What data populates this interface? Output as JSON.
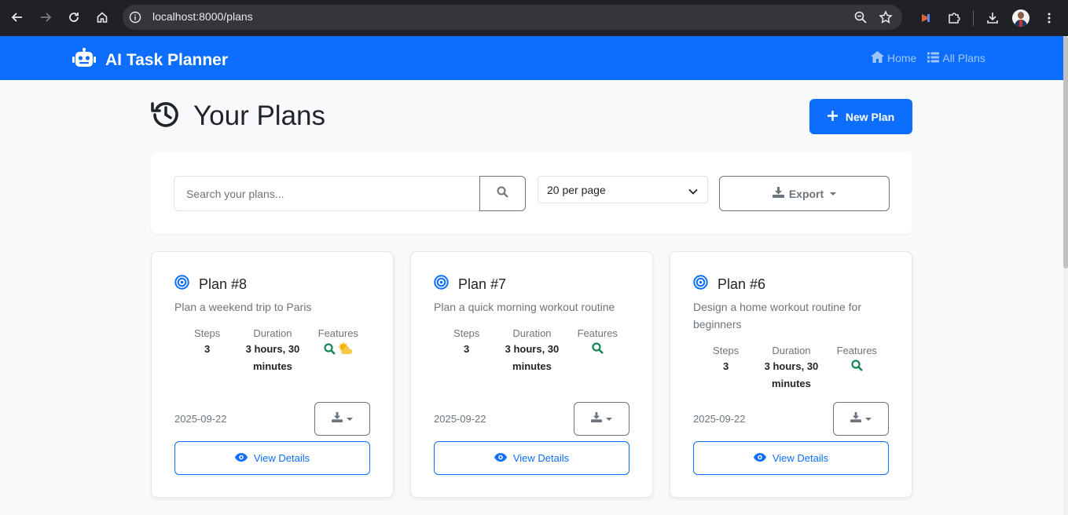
{
  "browser": {
    "url": "localhost:8000/plans"
  },
  "navbar": {
    "brand": "AI Task Planner",
    "links": [
      {
        "label": "Home",
        "icon": "home-icon"
      },
      {
        "label": "All Plans",
        "icon": "list-icon"
      }
    ]
  },
  "header": {
    "title": "Your Plans",
    "new_plan_label": "New Plan"
  },
  "toolbar": {
    "search_placeholder": "Search your plans...",
    "per_page": "20 per page",
    "export_label": "Export"
  },
  "colors": {
    "primary": "#0d6efd",
    "success": "#198754",
    "warning": "#f5b400"
  },
  "plans": [
    {
      "title": "Plan #8",
      "description": "Plan a weekend trip to Paris",
      "steps_label": "Steps",
      "steps": "3",
      "duration_label": "Duration",
      "duration": "3 hours, 30 minutes",
      "features_label": "Features",
      "features": [
        "search-icon",
        "weather-icon"
      ],
      "date": "2025-09-22",
      "view_label": "View Details"
    },
    {
      "title": "Plan #7",
      "description": "Plan a quick morning workout routine",
      "steps_label": "Steps",
      "steps": "3",
      "duration_label": "Duration",
      "duration": "3 hours, 30 minutes",
      "features_label": "Features",
      "features": [
        "search-icon"
      ],
      "date": "2025-09-22",
      "view_label": "View Details"
    },
    {
      "title": "Plan #6",
      "description": "Design a home workout routine for beginners",
      "steps_label": "Steps",
      "steps": "3",
      "duration_label": "Duration",
      "duration": "3 hours, 30 minutes",
      "features_label": "Features",
      "features": [
        "search-icon"
      ],
      "date": "2025-09-22",
      "view_label": "View Details"
    }
  ]
}
